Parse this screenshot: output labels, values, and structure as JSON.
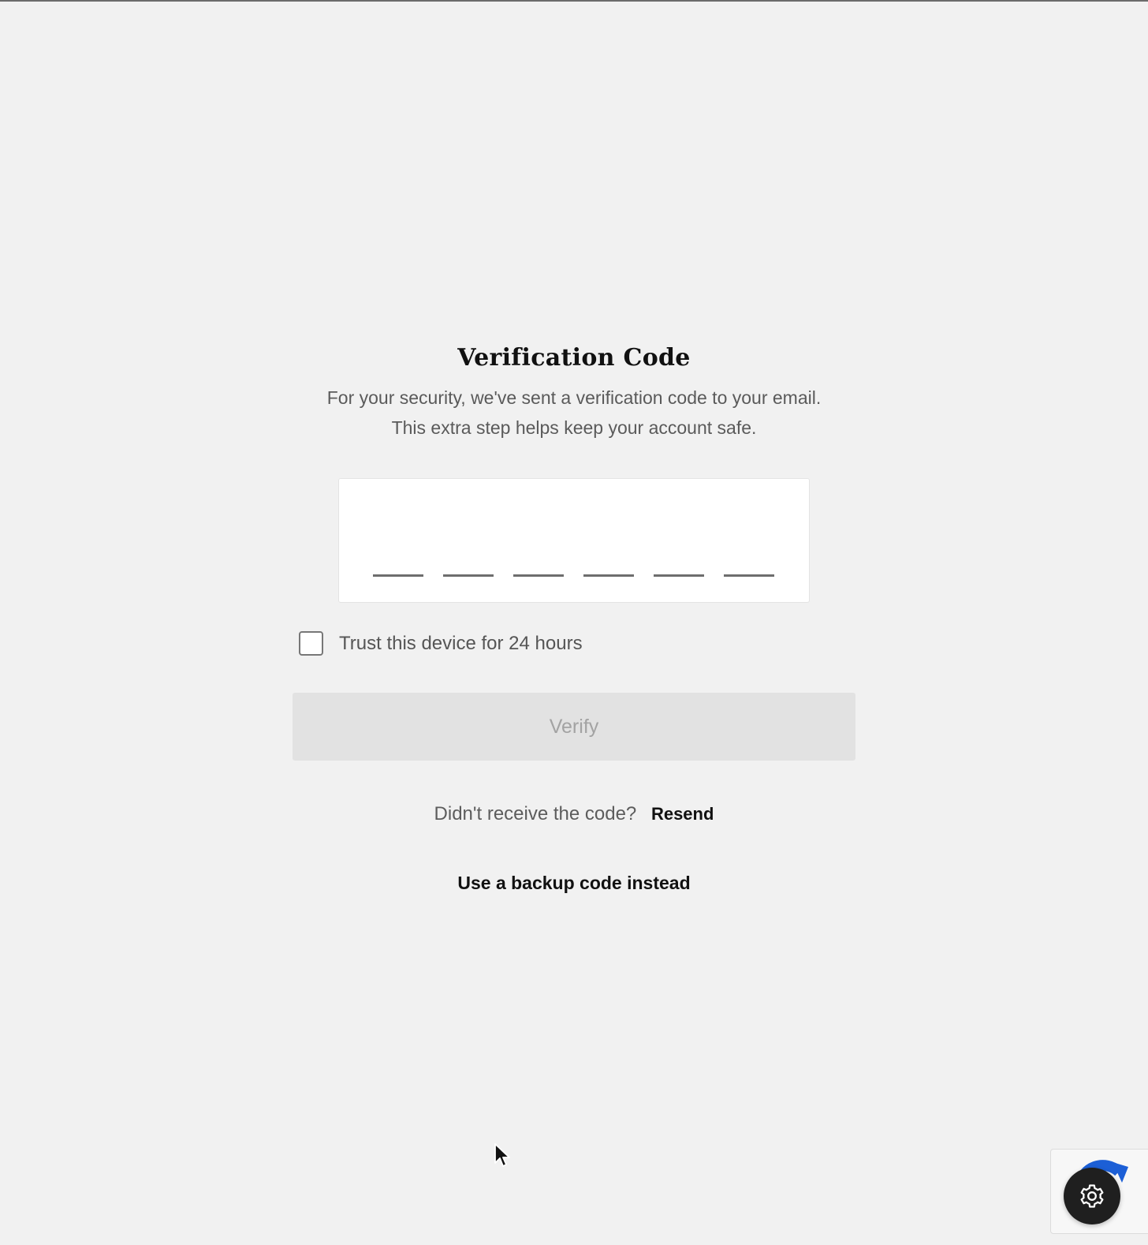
{
  "header": {
    "title": "Verification Code",
    "subtitle_line1": "For your security, we've sent a verification code to your email.",
    "subtitle_line2": "This extra step helps keep your account safe."
  },
  "code_input": {
    "digits": [
      "",
      "",
      "",
      "",
      "",
      ""
    ]
  },
  "trust_device": {
    "label": "Trust this device for 24 hours",
    "checked": false
  },
  "verify": {
    "label": "Verify",
    "enabled": false
  },
  "resend": {
    "prompt": "Didn't receive the code?",
    "link_label": "Resend"
  },
  "backup": {
    "link_label": "Use a backup code instead"
  },
  "icons": {
    "cursor": "mouse-pointer-icon",
    "settings": "gear-icon",
    "widget": "recaptcha-icon"
  },
  "colors": {
    "background": "#f1f1f1",
    "button_disabled_bg": "#e2e2e2",
    "button_disabled_text": "#a3a3a3",
    "widget_accent": "#1c5fd6"
  }
}
